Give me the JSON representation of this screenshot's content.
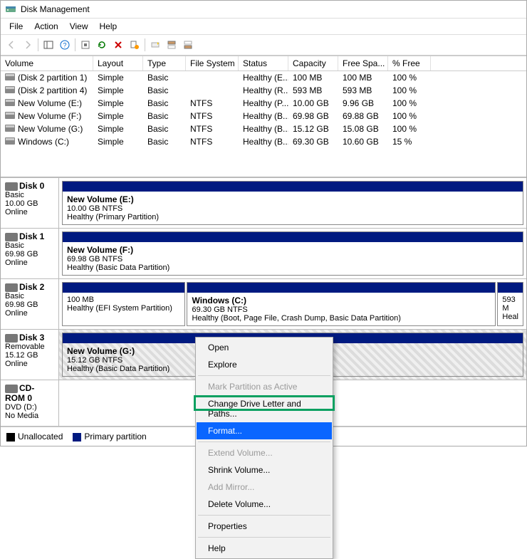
{
  "title": "Disk Management",
  "menu": [
    "File",
    "Action",
    "View",
    "Help"
  ],
  "columns": [
    "Volume",
    "Layout",
    "Type",
    "File System",
    "Status",
    "Capacity",
    "Free Spa...",
    "% Free"
  ],
  "volumes": [
    {
      "name": "(Disk 2 partition 1)",
      "layout": "Simple",
      "type": "Basic",
      "fs": "",
      "status": "Healthy (E...",
      "cap": "100 MB",
      "free": "100 MB",
      "pct": "100 %"
    },
    {
      "name": "(Disk 2 partition 4)",
      "layout": "Simple",
      "type": "Basic",
      "fs": "",
      "status": "Healthy (R...",
      "cap": "593 MB",
      "free": "593 MB",
      "pct": "100 %"
    },
    {
      "name": "New Volume (E:)",
      "layout": "Simple",
      "type": "Basic",
      "fs": "NTFS",
      "status": "Healthy (P...",
      "cap": "10.00 GB",
      "free": "9.96 GB",
      "pct": "100 %"
    },
    {
      "name": "New Volume (F:)",
      "layout": "Simple",
      "type": "Basic",
      "fs": "NTFS",
      "status": "Healthy (B...",
      "cap": "69.98 GB",
      "free": "69.88 GB",
      "pct": "100 %"
    },
    {
      "name": "New Volume (G:)",
      "layout": "Simple",
      "type": "Basic",
      "fs": "NTFS",
      "status": "Healthy (B...",
      "cap": "15.12 GB",
      "free": "15.08 GB",
      "pct": "100 %"
    },
    {
      "name": "Windows (C:)",
      "layout": "Simple",
      "type": "Basic",
      "fs": "NTFS",
      "status": "Healthy (B...",
      "cap": "69.30 GB",
      "free": "10.60 GB",
      "pct": "15 %"
    }
  ],
  "disks": [
    {
      "title": "Disk 0",
      "type": "Basic",
      "size": "10.00 GB",
      "state": "Online",
      "parts": [
        {
          "title": "New Volume  (E:)",
          "sub": "10.00 GB NTFS",
          "status": "Healthy (Primary Partition)",
          "flex": 1
        }
      ]
    },
    {
      "title": "Disk 1",
      "type": "Basic",
      "size": "69.98 GB",
      "state": "Online",
      "parts": [
        {
          "title": "New Volume  (F:)",
          "sub": "69.98 GB NTFS",
          "status": "Healthy (Basic Data Partition)",
          "flex": 1
        }
      ]
    },
    {
      "title": "Disk 2",
      "type": "Basic",
      "size": "69.98 GB",
      "state": "Online",
      "parts": [
        {
          "title": "",
          "sub": "100 MB",
          "status": "Healthy (EFI System Partition)",
          "flex": 0.27
        },
        {
          "title": "Windows  (C:)",
          "sub": "69.30 GB NTFS",
          "status": "Healthy (Boot, Page File, Crash Dump, Basic Data Partition)",
          "flex": 0.68
        },
        {
          "title": "",
          "sub": "593 M",
          "status": "Heal",
          "flex": 0.05
        }
      ]
    },
    {
      "title": "Disk 3",
      "type": "Removable",
      "size": "15.12 GB",
      "state": "Online",
      "hatched": true,
      "parts": [
        {
          "title": "New Volume  (G:)",
          "sub": "15.12 GB NTFS",
          "status": "Healthy (Basic Data Partition)",
          "flex": 1
        }
      ]
    },
    {
      "title": "CD-ROM 0",
      "type": "DVD (D:)",
      "size": "",
      "state": "No Media",
      "cdrom": true,
      "parts": []
    }
  ],
  "legend": {
    "unalloc": "Unallocated",
    "primary": "Primary partition",
    "unalloc_color": "#000",
    "primary_color": "#001a80"
  },
  "context": [
    {
      "label": "Open",
      "type": "item"
    },
    {
      "label": "Explore",
      "type": "item"
    },
    {
      "type": "sep"
    },
    {
      "label": "Mark Partition as Active",
      "type": "item",
      "disabled": true
    },
    {
      "label": "Change Drive Letter and Paths...",
      "type": "item"
    },
    {
      "label": "Format...",
      "type": "item",
      "highlight": true
    },
    {
      "type": "sep"
    },
    {
      "label": "Extend Volume...",
      "type": "item",
      "disabled": true
    },
    {
      "label": "Shrink Volume...",
      "type": "item"
    },
    {
      "label": "Add Mirror...",
      "type": "item",
      "disabled": true
    },
    {
      "label": "Delete Volume...",
      "type": "item"
    },
    {
      "type": "sep"
    },
    {
      "label": "Properties",
      "type": "item"
    },
    {
      "type": "sep"
    },
    {
      "label": "Help",
      "type": "item"
    }
  ]
}
